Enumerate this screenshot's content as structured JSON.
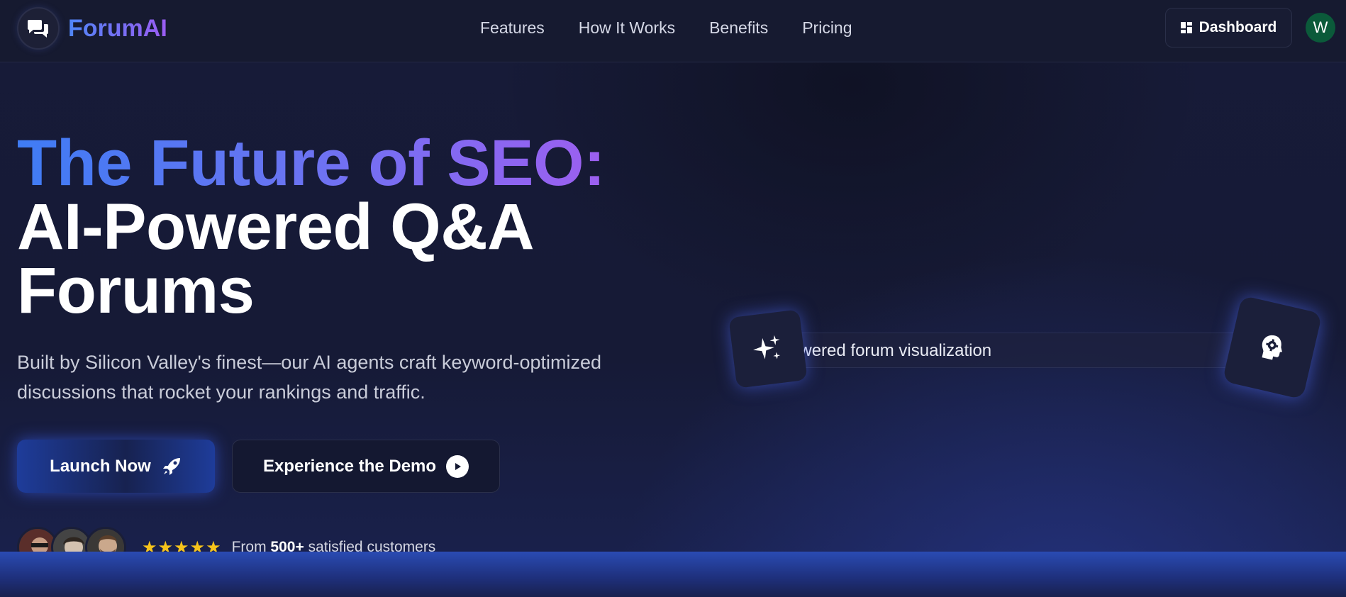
{
  "brand": {
    "name": "ForumAI"
  },
  "nav": {
    "links": [
      "Features",
      "How It Works",
      "Benefits",
      "Pricing"
    ],
    "dashboard_label": "Dashboard",
    "avatar_initial": "W"
  },
  "hero": {
    "title_gradient": "The Future of SEO:",
    "title_line2": "AI-Powered Q&A",
    "title_line3": "Forums",
    "subtitle": "Built by Silicon Valley's finest—our AI agents craft keyword-optimized discussions that rocket your rankings and traffic.",
    "primary_cta": "Launch Now",
    "secondary_cta": "Experience the Demo"
  },
  "social_proof": {
    "stars": "★★★★★",
    "prefix": "From",
    "count": "500+",
    "suffix": "satisfied customers"
  },
  "visualization": {
    "alt_text": "AI-powered forum visualization"
  },
  "colors": {
    "accent_blue": "#3f7cf4",
    "accent_purple": "#a55cf0",
    "star": "#f6c31b",
    "avatar_bg": "#0b5a3a"
  }
}
